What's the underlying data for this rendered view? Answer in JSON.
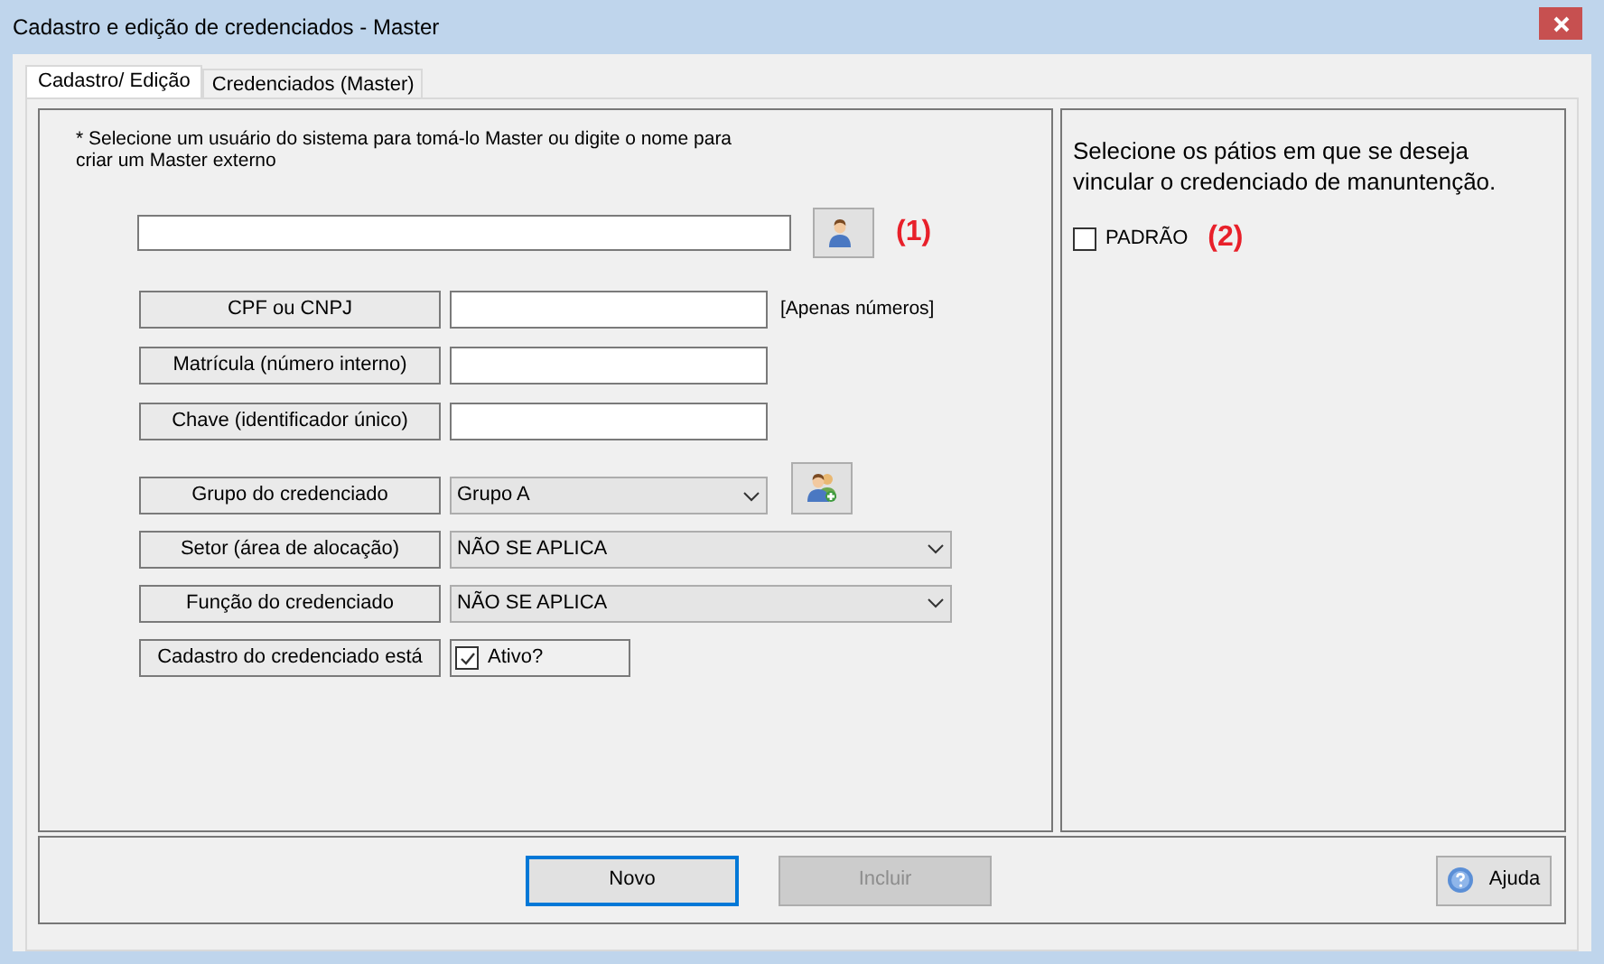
{
  "window": {
    "title": "Cadastro e edição de credenciados - Master"
  },
  "tabs": [
    {
      "label": "Cadastro/ Edição",
      "selected": true
    },
    {
      "label": "Credenciados (Master)",
      "selected": false
    }
  ],
  "form": {
    "note": "* Selecione um usuário do sistema para tomá-lo Master ou digite o nome para criar um Master externo",
    "marker": "(1)",
    "rows": [
      {
        "label": "CPF ou CNPJ",
        "kind": "text",
        "hint": "[Apenas números]"
      },
      {
        "label": "Matrícula (número interno)",
        "kind": "text"
      },
      {
        "label": "Chave (identificador único)",
        "kind": "text"
      },
      {
        "label": "Grupo do credenciado",
        "kind": "combo",
        "value": "Grupo A",
        "wide": false,
        "add_button": true
      },
      {
        "label": "Setor (área de alocação)",
        "kind": "combo",
        "value": "NÃO SE APLICA",
        "wide": true
      },
      {
        "label": "Função do credenciado",
        "kind": "combo",
        "value": "NÃO SE APLICA",
        "wide": true
      },
      {
        "label": "Cadastro do credenciado está",
        "kind": "checkbox",
        "option": "Ativo?",
        "checked": true
      }
    ]
  },
  "yards": {
    "instruction": "Selecione os pátios em que se deseja vincular o credenciado de manuntenção.",
    "marker": "(2)",
    "items": [
      {
        "label": "PADRÃO",
        "checked": false
      }
    ]
  },
  "buttons": [
    {
      "label": "Novo",
      "focused": true,
      "disabled": false
    },
    {
      "label": "Incluir",
      "focused": false,
      "disabled": true
    }
  ],
  "help_button": {
    "label": "Ajuda"
  }
}
